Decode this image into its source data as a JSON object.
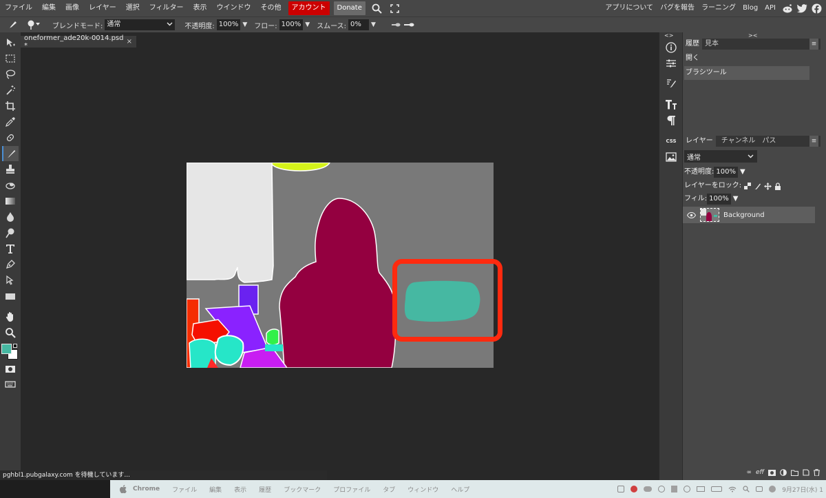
{
  "menu": {
    "items": [
      "ファイル",
      "編集",
      "画像",
      "レイヤー",
      "選択",
      "フィルター",
      "表示",
      "ウインドウ",
      "その他"
    ],
    "account": "アカウント",
    "donate": "Donate",
    "right_items": [
      "アプリについて",
      "バグを報告",
      "ラーニング",
      "Blog",
      "API"
    ]
  },
  "options": {
    "blend_label": "ブレンドモード:",
    "blend_value": "通常",
    "opacity_label": "不透明度:",
    "opacity_value": "100%",
    "flow_label": "フロー:",
    "flow_value": "100%",
    "smooth_label": "スムース:",
    "smooth_value": "0%"
  },
  "document": {
    "tab_name": "oneformer_ade20k-0014.psd *",
    "close": "×"
  },
  "history_panel": {
    "tabs": [
      "履歴",
      "見本"
    ],
    "items": [
      "開く",
      "ブラシツール"
    ]
  },
  "layers_panel": {
    "tabs": [
      "レイヤー",
      "チャンネル",
      "パス"
    ],
    "blend_value": "通常",
    "opacity_label": "不透明度:",
    "opacity_value": "100%",
    "lock_label": "レイヤーをロック:",
    "fill_label": "フィル:",
    "fill_value": "100%",
    "layer_name": "Background"
  },
  "strip": {
    "css_label": "CSS"
  },
  "status": {
    "text": "pghbl1.pubgalaxy.com を待機しています..."
  },
  "macbar": {
    "items": [
      "Chrome",
      "ファイル",
      "編集",
      "表示",
      "履歴",
      "ブックマーク",
      "プロファイル",
      "タブ",
      "ウィンドウ",
      "ヘルプ"
    ],
    "date": "9月27日(水) 1"
  },
  "colors": {
    "foreground": "#46b8a2",
    "background": "#ffffff",
    "highlight": "#ff2a0f",
    "accent": "#4a8fd6"
  }
}
